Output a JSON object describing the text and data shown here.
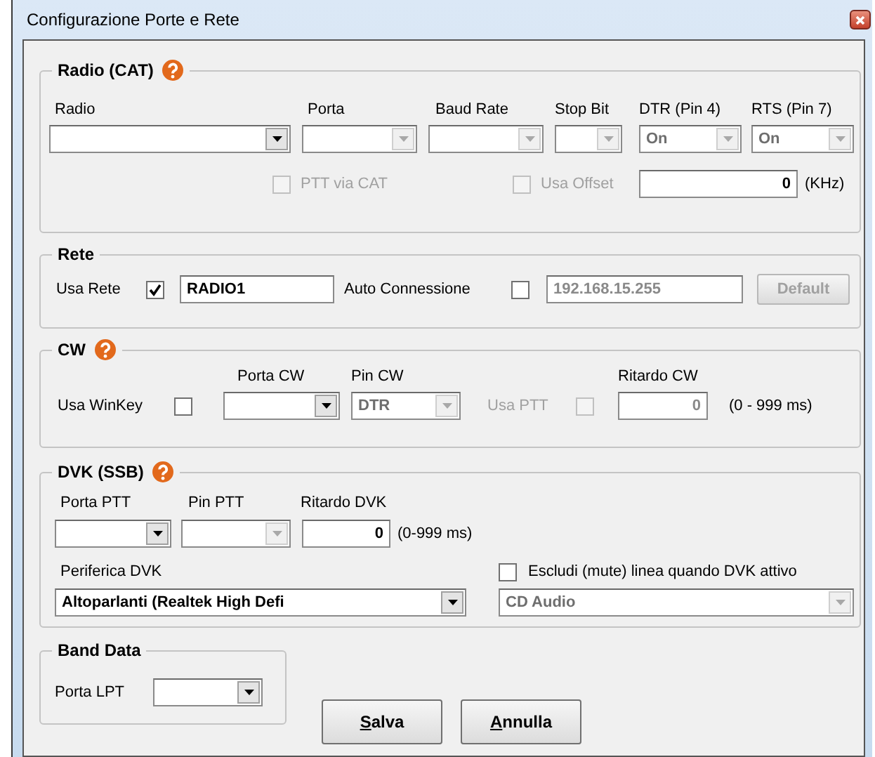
{
  "window": {
    "title": "Configurazione Porte e Rete"
  },
  "radio_cat": {
    "title": "Radio (CAT)",
    "help": true,
    "selectors": [
      {
        "label": "Radio",
        "disabled": false
      },
      {
        "label": "Porta",
        "disabled": true
      },
      {
        "label": "Baud Rate",
        "disabled": true
      },
      {
        "label": "Stop Bit",
        "disabled": true
      },
      {
        "label": "DTR (Pin 4)",
        "value": "On",
        "disabled": true
      },
      {
        "label": "RTS (Pin 7)",
        "value": "On",
        "disabled": true
      }
    ],
    "ptt_via_cat": {
      "label": "PTT via CAT",
      "checked": false,
      "disabled": true
    },
    "usa_offset": {
      "label": "Usa Offset",
      "checked": false,
      "disabled": true
    },
    "offset": {
      "value": "0",
      "unit": "(KHz)",
      "disabled": false
    }
  },
  "rete": {
    "title": "Rete",
    "usa_rete": {
      "label": "Usa Rete",
      "checked": true,
      "disabled": false
    },
    "name": {
      "value": "RADIO1",
      "disabled": false
    },
    "auto_connessione": {
      "label": "Auto Connessione",
      "checked": false,
      "disabled": false
    },
    "address": {
      "value": "192.168.15.255",
      "disabled": true
    },
    "default_button": {
      "label": "Default",
      "disabled": true
    }
  },
  "cw": {
    "title": "CW",
    "help": true,
    "usa_winkey": {
      "label": "Usa WinKey",
      "checked": false,
      "disabled": false
    },
    "porta_cw": {
      "label": "Porta CW",
      "disabled": false
    },
    "pin_cw": {
      "label": "Pin CW",
      "value": "DTR",
      "disabled": true
    },
    "usa_ptt": {
      "label": "Usa PTT",
      "checked": false,
      "disabled": true
    },
    "ritardo_cw": {
      "label": "Ritardo CW",
      "value": "0",
      "unit": "(0 - 999 ms)",
      "disabled": true
    }
  },
  "dvk": {
    "title": "DVK (SSB)",
    "help": true,
    "porta_ptt": {
      "label": "Porta PTT",
      "disabled": false
    },
    "pin_ptt": {
      "label": "Pin PTT",
      "disabled": true
    },
    "ritardo_dvk": {
      "label": "Ritardo DVK",
      "value": "0",
      "unit": "(0-999 ms)",
      "disabled": false
    },
    "periferica": {
      "label": "Periferica DVK",
      "value": "Altoparlanti (Realtek High Defi",
      "disabled": false
    },
    "escludi": {
      "label": "Escludi (mute) linea quando DVK attivo",
      "checked": false,
      "disabled": false
    },
    "linea": {
      "value": "CD Audio",
      "disabled": true
    }
  },
  "band_data": {
    "title": "Band Data",
    "porta_lpt": {
      "label": "Porta LPT",
      "disabled": false
    }
  },
  "buttons": [
    {
      "label": "Salva",
      "underline_first": true
    },
    {
      "label": "Annulla",
      "underline_first": true
    }
  ]
}
